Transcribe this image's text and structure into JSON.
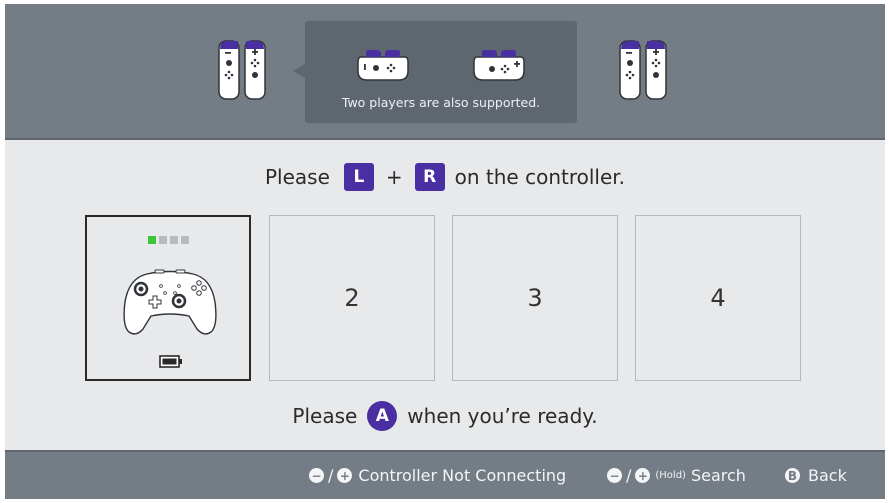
{
  "tooltip": {
    "text": "Two players are also supported."
  },
  "instruction_top": {
    "prefix": "Please",
    "key1": "L",
    "plus": "+",
    "key2": "R",
    "suffix": "on the controller."
  },
  "slots": [
    {
      "number": "2"
    },
    {
      "number": "3"
    },
    {
      "number": "4"
    }
  ],
  "active_slot": {
    "player_leds": [
      true,
      false,
      false,
      false
    ]
  },
  "instruction_bottom": {
    "prefix": "Please",
    "key": "A",
    "suffix": "when you’re ready."
  },
  "footer": {
    "controller_not_connecting": {
      "minus": "−",
      "slash": "/",
      "plus": "+",
      "label": "Controller Not Connecting"
    },
    "search": {
      "minus": "−",
      "slash": "/",
      "plus": "+",
      "hold": "(Hold)",
      "label": "Search"
    },
    "back": {
      "key": "B",
      "label": "Back"
    }
  },
  "colors": {
    "header": "#747c85",
    "accent": "#4a2fa3",
    "led_on": "#3cc43c",
    "background": "#e8e9eb"
  }
}
